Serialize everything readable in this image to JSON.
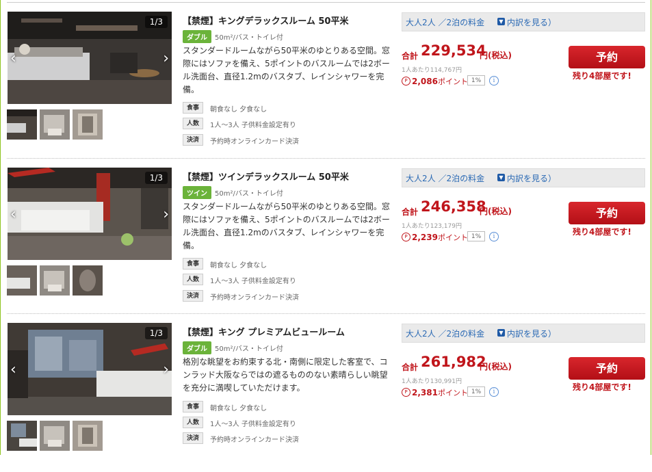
{
  "rooms": [
    {
      "counter": "1/3",
      "title": "【禁煙】キングデラックスルーム 50平米",
      "bed_tag": "ダブル",
      "spec": "50m²/バス・トイレ付",
      "description": "スタンダードルームながら50平米のゆとりある空間。窓際にはソファを備え、5ポイントのバスルームでは2ボール洗面台、直径1.2mのバスタブ、レインシャワーを完備。",
      "meal_label": "食事",
      "meal_value": "朝食なし 夕食なし",
      "guests_label": "人数",
      "guests_value": "1人～3人 子供料金設定有り",
      "payment_label": "決済",
      "payment_value": "予約時オンラインカード決済",
      "price_bar_text": "大人2人 ／2泊の料金",
      "breakdown_link": "内訳を見る）",
      "total_label": "合計",
      "total_price": "229,534",
      "yen_tax": "円(税込)",
      "per_person": "1人あたり114,767円",
      "points": "2,086",
      "points_unit": "ポイント",
      "point_rate": "1%",
      "reserve_label": "予約",
      "rooms_left": "残り4部屋です!"
    },
    {
      "counter": "1/3",
      "title": "【禁煙】ツインデラックスルーム 50平米",
      "bed_tag": "ツイン",
      "spec": "50m²/バス・トイレ付",
      "description": "スタンダードルームながら50平米のゆとりある空間。窓際にはソファを備え、5ポイントのバスルームでは2ボール洗面台、直径1.2mのバスタブ、レインシャワーを完備。",
      "meal_label": "食事",
      "meal_value": "朝食なし 夕食なし",
      "guests_label": "人数",
      "guests_value": "1人～3人 子供料金設定有り",
      "payment_label": "決済",
      "payment_value": "予約時オンラインカード決済",
      "price_bar_text": "大人2人 ／2泊の料金",
      "breakdown_link": "内訳を見る）",
      "total_label": "合計",
      "total_price": "246,358",
      "yen_tax": "円(税込)",
      "per_person": "1人あたり123,179円",
      "points": "2,239",
      "points_unit": "ポイント",
      "point_rate": "1%",
      "reserve_label": "予約",
      "rooms_left": "残り4部屋です!"
    },
    {
      "counter": "1/3",
      "title": "【禁煙】キング プレミアムビュールーム",
      "bed_tag": "ダブル",
      "spec": "50m²/バス・トイレ付",
      "description": "格別な眺望をお約束する北・南側に限定した客室で、コンラッド大阪ならではの遮るもののない素晴らしい眺望を充分に満喫していただけます。",
      "meal_label": "食事",
      "meal_value": "朝食なし 夕食なし",
      "guests_label": "人数",
      "guests_value": "1人～3人 子供料金設定有り",
      "payment_label": "決済",
      "payment_value": "予約時オンラインカード決済",
      "price_bar_text": "大人2人 ／2泊の料金",
      "breakdown_link": "内訳を見る）",
      "total_label": "合計",
      "total_price": "261,982",
      "yen_tax": "円(税込)",
      "per_person": "1人あたり130,991円",
      "points": "2,381",
      "points_unit": "ポイント",
      "point_rate": "1%",
      "reserve_label": "予約",
      "rooms_left": "残り4部屋です!"
    }
  ],
  "colors": {
    "accent_green": "#8fc31f",
    "tag_green": "#6bb33a",
    "price_red": "#c0151b",
    "link_blue": "#2a69b4"
  },
  "icons": {
    "prev": "chevron-left-icon",
    "next": "chevron-right-icon",
    "breakdown": "triangle-down-icon",
    "points": "point-icon",
    "info": "info-icon"
  }
}
